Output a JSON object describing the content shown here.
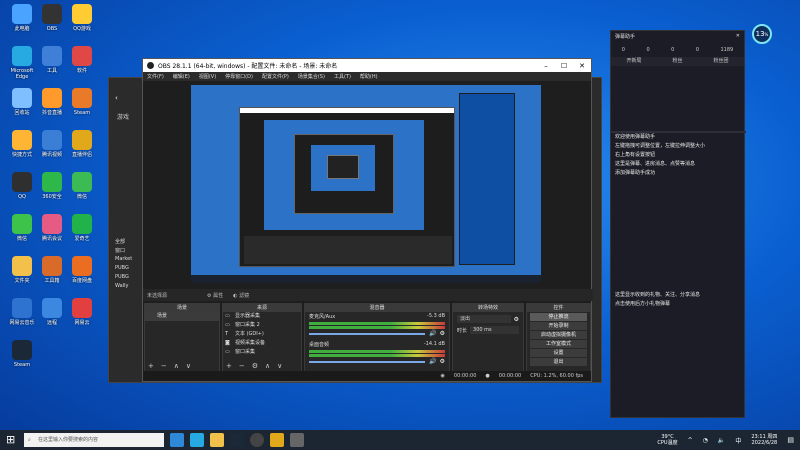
{
  "desktop": {
    "icons": [
      {
        "label": "此电脑",
        "color": "#4aa3ff"
      },
      {
        "label": "OBS",
        "color": "#333333"
      },
      {
        "label": "QQ游戏",
        "color": "#ffcc33"
      },
      {
        "label": "Microsoft Edge",
        "color": "#27a9e1"
      },
      {
        "label": "工具",
        "color": "#3f7fd8"
      },
      {
        "label": "软件",
        "color": "#e04848"
      },
      {
        "label": "回收站",
        "color": "#7fbfff"
      },
      {
        "label": "抖音直播",
        "color": "#ff9a2b"
      },
      {
        "label": "Steam",
        "color": "#e87a2a"
      },
      {
        "label": "快捷方式",
        "color": "#ffb534"
      },
      {
        "label": "腾讯视频",
        "color": "#3a7fd5"
      },
      {
        "label": "直播伴侣",
        "color": "#e0a81a"
      },
      {
        "label": "QQ",
        "color": "#2f2f2f"
      },
      {
        "label": "360安全",
        "color": "#2eb84a"
      },
      {
        "label": "微信",
        "color": "#3cba54"
      },
      {
        "label": "微信",
        "color": "#3ec34a"
      },
      {
        "label": "腾讯会议",
        "color": "#e65b84"
      },
      {
        "label": "爱奇艺",
        "color": "#21b24a"
      },
      {
        "label": "文件夹",
        "color": "#f3c14b"
      },
      {
        "label": "工具箱",
        "color": "#d96b2a"
      },
      {
        "label": "百度网盘",
        "color": "#ea6d21"
      },
      {
        "label": "网易云音乐",
        "color": "#2f73d1"
      },
      {
        "label": "远程",
        "color": "#3c88e0"
      },
      {
        "label": "网易云",
        "color": "#e24040"
      },
      {
        "label": "Steam",
        "color": "#1b2838"
      }
    ]
  },
  "obs": {
    "title": "OBS 28.1.1 (64-bit, windows) - 配置文件: 未命名 - 场景: 未命名",
    "menu": [
      "文件(F)",
      "编辑(E)",
      "视图(V)",
      "停靠窗口(D)",
      "配置文件(P)",
      "场景集合(S)",
      "工具(T)",
      "帮助(H)"
    ],
    "source_toolbar": {
      "no_source": "未选择源",
      "properties": "属性",
      "filters": "滤镜"
    },
    "docks": {
      "scenes": "场景",
      "sources": "来源",
      "mixer": "混音器",
      "transitions": "转场特效",
      "controls": "控件"
    },
    "scenes": [
      "场景"
    ],
    "sources": [
      "显示器采集",
      "窗口采集 2",
      "文本 (GDI+)",
      "视频采集设备",
      "窗口采集"
    ],
    "mixer": {
      "ch1": {
        "name": "麦克风/Aux",
        "db": "-5.3 dB"
      },
      "ch2": {
        "name": "桌面音频",
        "db": "-14.1 dB"
      }
    },
    "transitions": {
      "type": "淡出",
      "duration_label": "时长",
      "duration": "300 ms"
    },
    "controls": [
      "停止推流",
      "开始录制",
      "启动虚拟摄像机",
      "工作室模式",
      "设置",
      "退出"
    ],
    "status": {
      "live": "00:00:00",
      "rec": "00:00:00",
      "cpu": "CPU: 1.2%, 60.00 fps"
    },
    "colors": {
      "stop_btn": "#5a5a5a",
      "accent": "#3c7ad8"
    }
  },
  "backwin": {
    "title": "游戏",
    "items": [
      "全部",
      "窗口",
      "Market",
      "PUBG",
      "PUBG",
      "Wally"
    ]
  },
  "widget": {
    "header": "弹幕助手",
    "stats": [
      "0",
      "0",
      "0",
      "0",
      "1189"
    ],
    "tabs": [
      "开新局",
      "粉丝",
      "粉丝团"
    ],
    "lines": [
      "欢迎使用弹幕助手",
      "左键拖拽可调整位置，左键拉伸调整大小",
      "右上角有设置按钮",
      "这里是弹幕、进房消息、点赞等消息",
      "添加弹幕助手成功"
    ],
    "lines2": [
      "这里显示收到的礼物、关注、分享消息",
      "点击使用后方小礼物弹幕"
    ],
    "weather": {
      "temp": "13",
      "unit": "%"
    }
  },
  "taskbar": {
    "search_placeholder": "在这里输入你要搜索的内容",
    "tray": {
      "temp": "39°C",
      "temp_label": "CPU温度",
      "time": "23:11 周四",
      "date": "2022/6/28"
    }
  }
}
